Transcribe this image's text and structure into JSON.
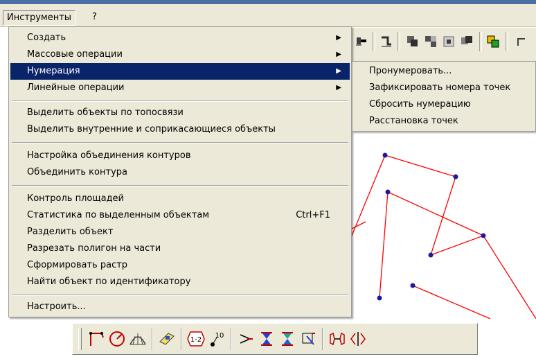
{
  "menubar": {
    "items": [
      {
        "label": "Инструменты"
      },
      {
        "label": "?"
      }
    ]
  },
  "menu": {
    "items": [
      {
        "label": "Создать",
        "submenu": true
      },
      {
        "label": "Массовые операции",
        "submenu": true
      },
      {
        "label": "Нумерация",
        "submenu": true,
        "highlighted": true
      },
      {
        "label": "Линейные операции",
        "submenu": true
      },
      {
        "label": "Выделить объекты по топосвязи"
      },
      {
        "label": "Выделить внутренние и соприкасающиеся объекты"
      },
      {
        "label": "Настройка объединения контуров"
      },
      {
        "label": "Объединить контура"
      },
      {
        "label": "Контроль площадей"
      },
      {
        "label": "Статистика по выделенным объектам",
        "shortcut": "Ctrl+F1"
      },
      {
        "label": "Разделить объект"
      },
      {
        "label": "Разрезать полигон на части"
      },
      {
        "label": "Сформировать растр"
      },
      {
        "label": "Найти объект по идентификатору"
      },
      {
        "label": "Настроить..."
      }
    ]
  },
  "submenu": {
    "items": [
      {
        "label": "Пронумеровать..."
      },
      {
        "label": "Зафиксировать номера точек"
      },
      {
        "label": "Сбросить нумерацию"
      },
      {
        "label": "Расстановка точек"
      }
    ]
  },
  "colors": {
    "highlight": "#0a246a",
    "menu_bg": "#ece9d8",
    "polygon_line": "#ff0000",
    "vertex": "#1a1aa0"
  },
  "icons": {
    "arrow": "▶",
    "bottom_toolbar": [
      "polyline-icon",
      "circle-icon",
      "arc-fan-icon",
      "label-icon",
      "number-1-2-icon",
      "point-10-icon",
      "angle-icon",
      "hourglass-blue-icon",
      "hourglass-green-icon",
      "box-cursor-icon",
      "merge-icon",
      "split-icon"
    ]
  },
  "bottom_toolbar": {
    "num_label": "1-2",
    "point_label": "10"
  }
}
